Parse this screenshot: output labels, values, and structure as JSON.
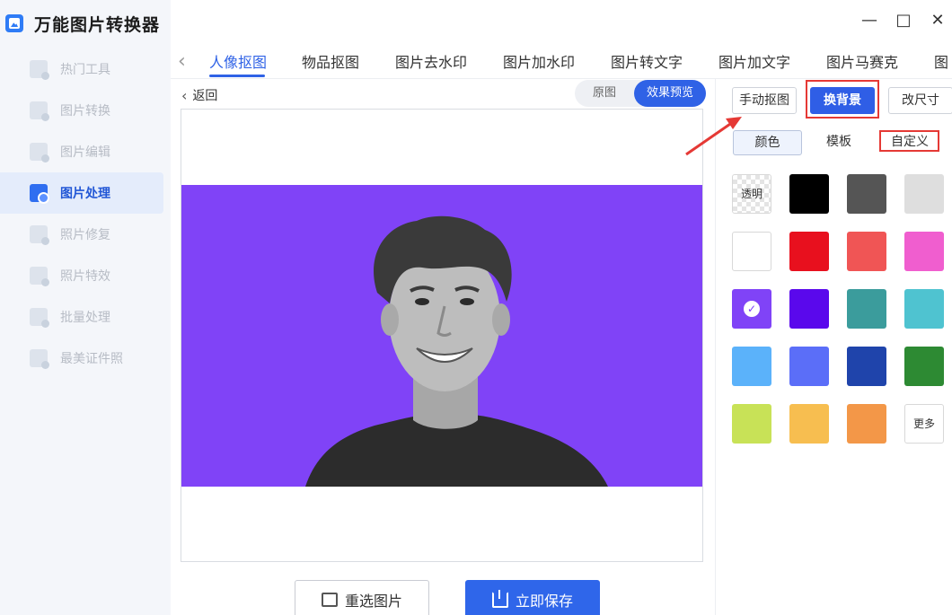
{
  "app": {
    "title": "万能图片转换器"
  },
  "window_controls": {
    "minimize": "—",
    "maximize": "□",
    "close": "✕"
  },
  "sidebar": {
    "items": [
      {
        "label": "热门工具",
        "icon": "hot-tools-icon"
      },
      {
        "label": "图片转换",
        "icon": "image-convert-icon"
      },
      {
        "label": "图片编辑",
        "icon": "image-edit-icon"
      },
      {
        "label": "图片处理",
        "icon": "image-process-icon",
        "active": true
      },
      {
        "label": "照片修复",
        "icon": "photo-repair-icon"
      },
      {
        "label": "照片特效",
        "icon": "photo-effects-icon"
      },
      {
        "label": "批量处理",
        "icon": "batch-process-icon"
      },
      {
        "label": "最美证件照",
        "icon": "id-photo-icon"
      }
    ]
  },
  "tabs": {
    "prev_arrow": "‹",
    "items": [
      {
        "label": "人像抠图",
        "active": true
      },
      {
        "label": "物品抠图"
      },
      {
        "label": "图片去水印"
      },
      {
        "label": "图片加水印"
      },
      {
        "label": "图片转文字"
      },
      {
        "label": "图片加文字"
      },
      {
        "label": "图片马赛克"
      },
      {
        "label": "图"
      }
    ]
  },
  "preview": {
    "back_chevron": "‹",
    "back_label": "返回",
    "toggle_original": "原图",
    "toggle_preview": "效果预览",
    "background_color": "#8043f7"
  },
  "actions": {
    "reselect_label": "重选图片",
    "save_label": "立即保存"
  },
  "right_panel": {
    "modes": {
      "manual_cutout": "手动抠图",
      "change_background": "换背景",
      "resize": "改尺寸"
    },
    "subtabs": {
      "color": "颜色",
      "template": "模板",
      "custom": "自定义"
    },
    "transparent_label": "透明",
    "more_label": "更多",
    "selected_mark": "✓",
    "swatch_colors": [
      "transparent",
      "#000000",
      "#555555",
      "#dedede",
      "#ffffff",
      "#e8101e",
      "#f05555",
      "#f05ecf",
      "#8043f7",
      "#5a08ec",
      "#3b9c9c",
      "#4fc3d0",
      "#5bb2fa",
      "#5b6ef8",
      "#1f44ab",
      "#2d8a33",
      "#c8e257",
      "#f7be50",
      "#f39748",
      "more"
    ],
    "selected_color": "#8043f7"
  },
  "colors": {
    "accent": "#2f62e6",
    "highlight_red": "#e53935"
  }
}
